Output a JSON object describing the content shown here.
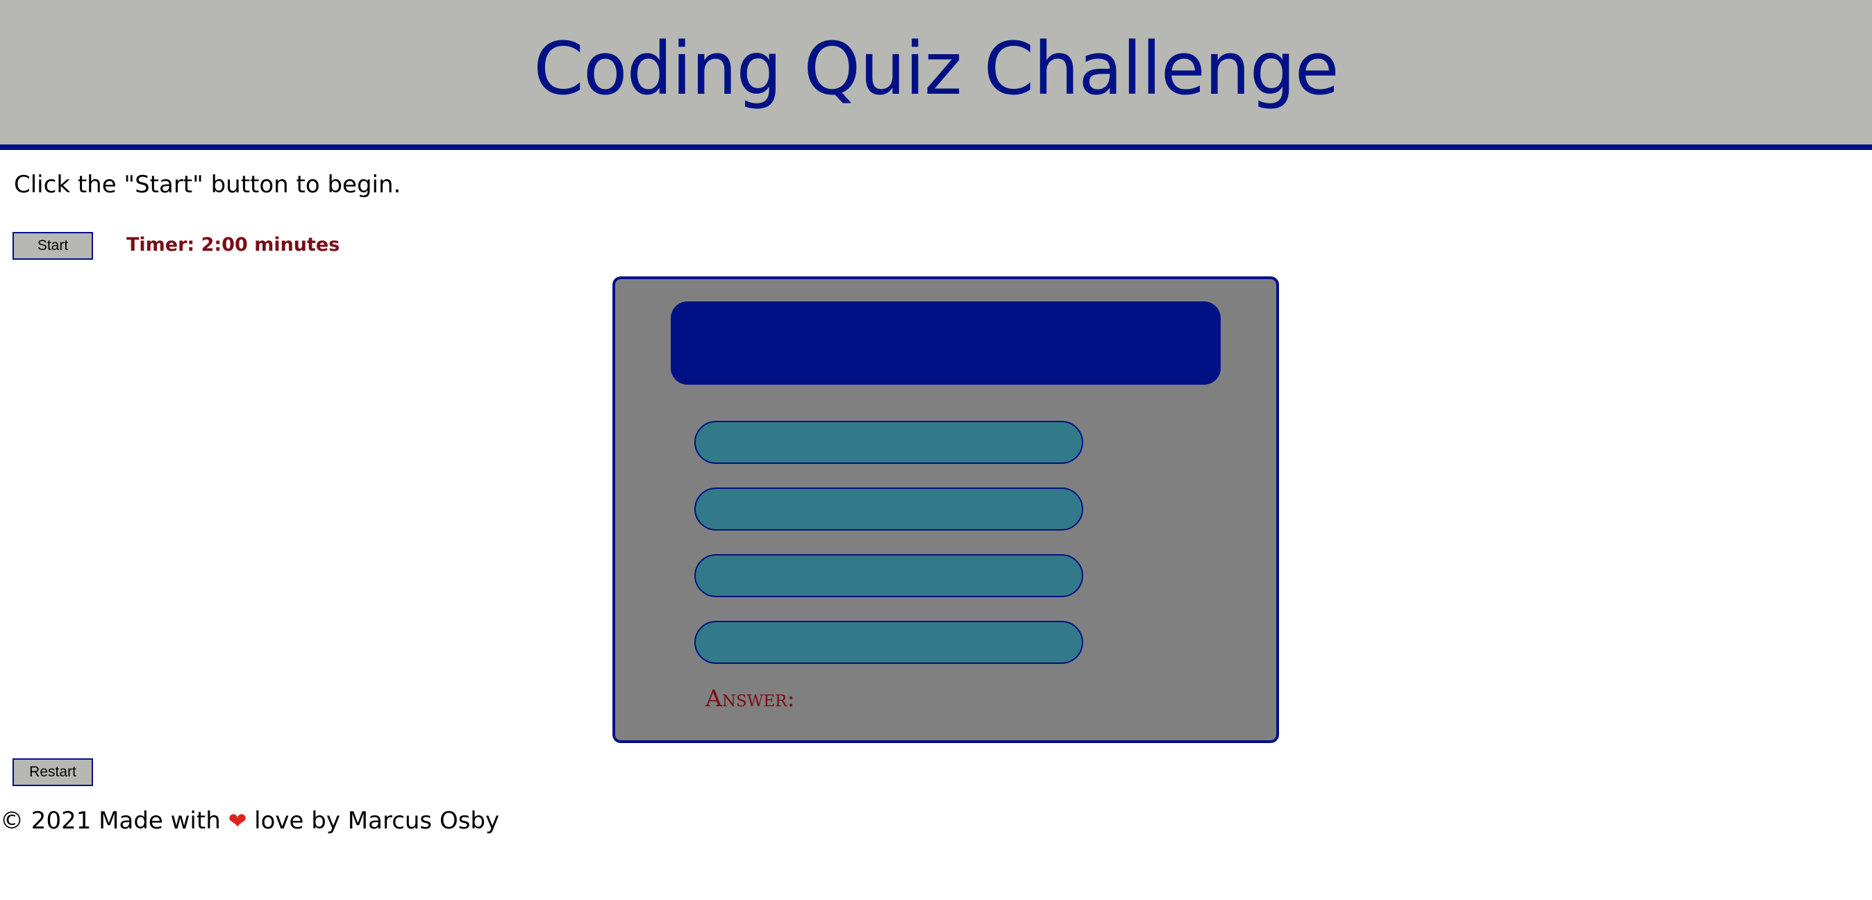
{
  "header": {
    "title": "Coding Quiz Challenge"
  },
  "instructions": "Click the \"Start\" button to begin.",
  "controls": {
    "start_label": "Start",
    "timer_text": "Timer: 2:00 minutes",
    "restart_label": "Restart"
  },
  "quiz": {
    "question": "",
    "choices": [
      "",
      "",
      "",
      ""
    ],
    "answer_label": "Answer:"
  },
  "footer": {
    "prefix": "© 2021 Made with ",
    "heart": "❤",
    "suffix": " love by Marcus Osby"
  },
  "colors": {
    "header_bg": "#b7b8b3",
    "accent_navy": "#001185",
    "timer_red": "#7a0d16",
    "card_gray": "#808080",
    "choice_teal": "#327a89",
    "heart_red": "#e0241c"
  },
  "icons": {
    "heart": "heart-icon"
  }
}
